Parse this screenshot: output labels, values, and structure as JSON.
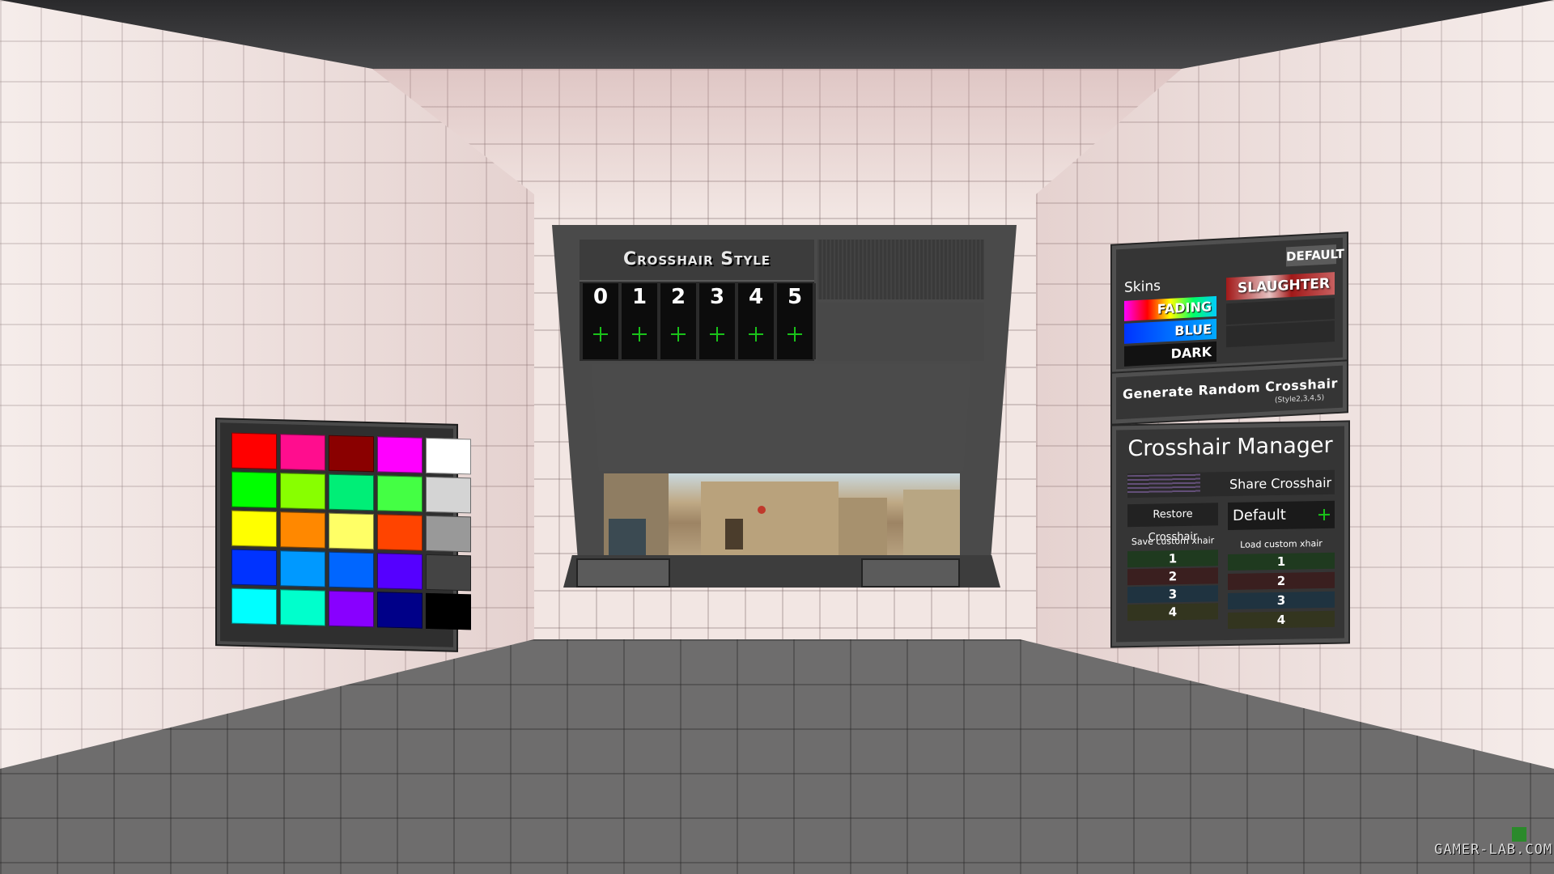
{
  "crosshair_style": {
    "title": "Crosshair Style",
    "styles": [
      "0",
      "1",
      "2",
      "3",
      "4",
      "5"
    ]
  },
  "palette": {
    "colors": [
      "#ff0000",
      "#ff0d8e",
      "#8a0000",
      "#ff00ff",
      "#ffffff",
      "#00ff00",
      "#88ff00",
      "#00ee77",
      "#44ff44",
      "#d4d4d4",
      "#ffff00",
      "#ff8800",
      "#ffff66",
      "#ff4400",
      "#999999",
      "#0033ff",
      "#0099ff",
      "#0066ff",
      "#5500ff",
      "#444444",
      "#00ffff",
      "#00ffcc",
      "#8800ff",
      "#000088",
      "#000000"
    ]
  },
  "skins": {
    "label": "Skins",
    "default_label": "DEFAULT",
    "fading_label": "FADING",
    "blue_label": "BLUE",
    "dark_label": "DARK",
    "slaughter_label": "SLAUGHTER"
  },
  "random": {
    "title": "Generate Random Crosshair",
    "subtitle": "(Style2,3,4,5)"
  },
  "manager": {
    "title": "Crosshair Manager",
    "share_label": "Share Crosshair",
    "restore_label": "Restore Crosshair",
    "current_value": "Default",
    "save_label": "Save custom xhair",
    "load_label": "Load custom xhair",
    "save_slots": [
      "1",
      "2",
      "3",
      "4"
    ],
    "load_slots": [
      "1",
      "2",
      "3",
      "4"
    ],
    "slot_colors": [
      "#1f3a1f",
      "#3a1f1f",
      "#1f3340",
      "#33351f"
    ]
  },
  "watermark": "GAMER-LAB.COM"
}
